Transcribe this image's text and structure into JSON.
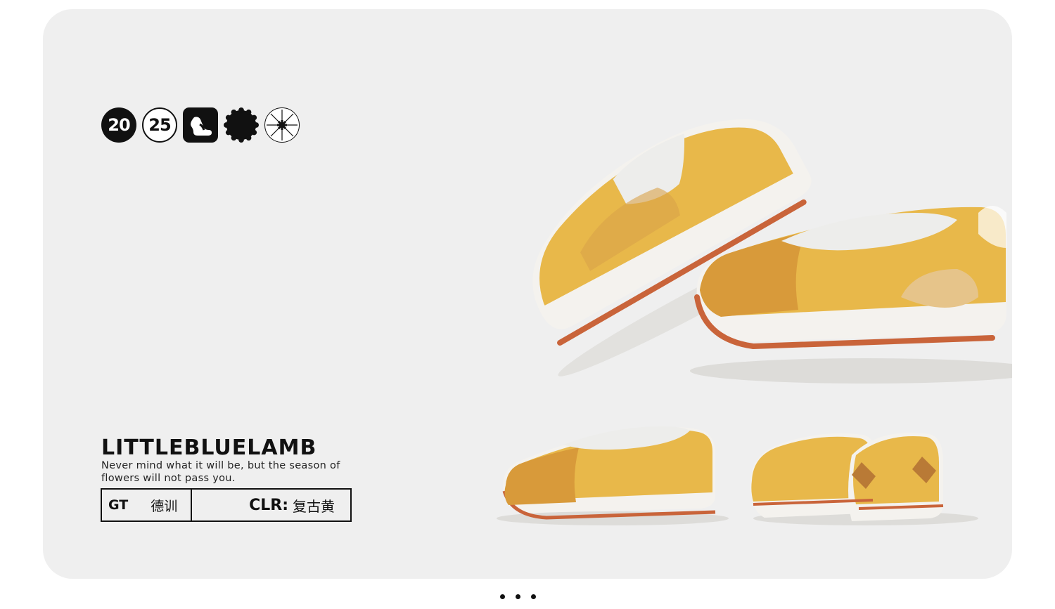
{
  "badges": {
    "year_part_1": "20",
    "year_part_2": "25",
    "icons": [
      "footprint-icon",
      "scallop-circle-icon",
      "starburst-icon"
    ]
  },
  "brand": {
    "name": "LITTLEBLUELAMB",
    "tagline": "Never mind what it will be, but the season of flowers will not pass you."
  },
  "product": {
    "code": "GT",
    "name_cn": "德训",
    "color_label": "CLR:",
    "color_value": "复古黄"
  },
  "colors": {
    "background": "#efefef",
    "shoe_yellow": "#e8b84a",
    "shoe_tan": "#d9a24a",
    "sole_white": "#f4f2ee",
    "sole_orange": "#c9643a"
  },
  "pager": {
    "count": 3
  }
}
